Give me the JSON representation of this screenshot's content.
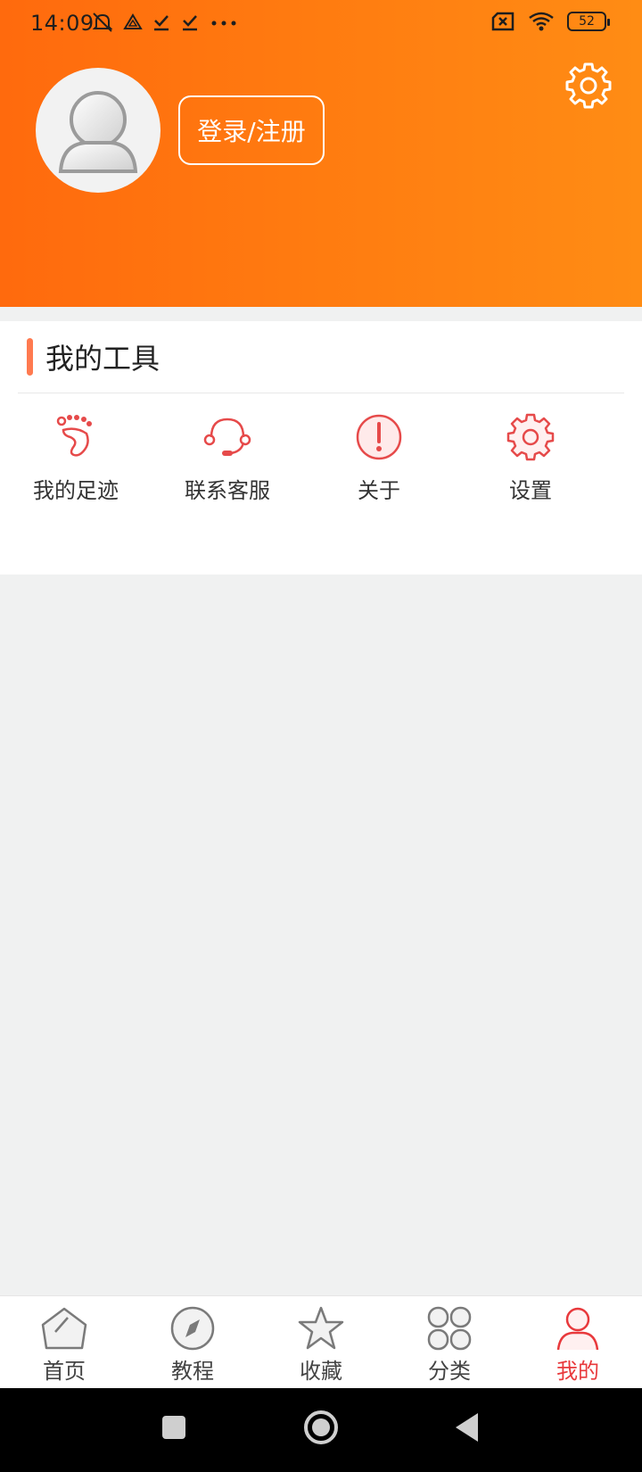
{
  "status_bar": {
    "time": "14:09",
    "battery": "52",
    "left_icons": [
      "mute-icon",
      "drive-icon",
      "download-done-icon",
      "download-done-icon",
      "more-icon"
    ],
    "right_icons": [
      "sim-off-icon",
      "wifi-icon",
      "battery-icon"
    ]
  },
  "header": {
    "login_label": "登录/注册",
    "gradient_start": "#ff6a0d",
    "gradient_end": "#ff8c14",
    "avatar_icon": "user-avatar-icon",
    "settings_icon": "gear-icon"
  },
  "tools": {
    "title": "我的工具",
    "accent": "#ff7a50",
    "items": [
      {
        "label": "我的足迹",
        "icon": "footprint-icon"
      },
      {
        "label": "联系客服",
        "icon": "headset-icon"
      },
      {
        "label": "关于",
        "icon": "info-alert-icon"
      },
      {
        "label": "设置",
        "icon": "gear-icon"
      }
    ]
  },
  "bottom_nav": {
    "active_color": "#e8393c",
    "items": [
      {
        "label": "首页",
        "icon": "home-icon"
      },
      {
        "label": "教程",
        "icon": "compass-icon"
      },
      {
        "label": "收藏",
        "icon": "star-icon"
      },
      {
        "label": "分类",
        "icon": "category-icon"
      },
      {
        "label": "我的",
        "icon": "user-icon",
        "active": true
      }
    ]
  },
  "system_nav": [
    "recent-apps-icon",
    "home-circle-icon",
    "back-icon"
  ]
}
